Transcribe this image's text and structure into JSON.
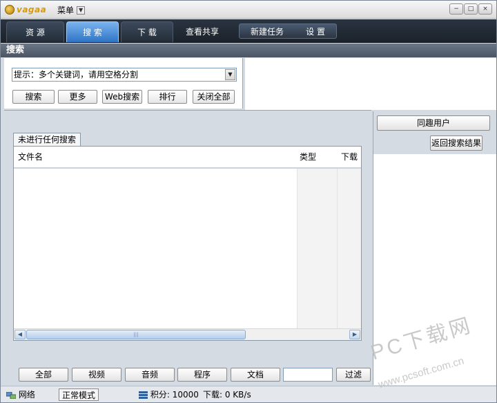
{
  "titlebar": {
    "logo_text": "vagaa",
    "menu_label": "菜单",
    "controls": [
      "−",
      "□",
      "×"
    ]
  },
  "nav": {
    "tabs": [
      "资 源",
      "搜 索",
      "下 载",
      "查看共享"
    ],
    "group": [
      "新建任务",
      "设 置"
    ]
  },
  "section_title": "搜索",
  "search": {
    "hint": "提示：多个关键词，请用空格分割",
    "buttons": [
      "搜索",
      "更多",
      "Web搜索",
      "排行",
      "关闭全部"
    ]
  },
  "results": {
    "tab_label": "未进行任何搜索",
    "columns": [
      "文件名",
      "类型",
      "下载"
    ],
    "scroll_grip": "|||"
  },
  "right_panel": {
    "same_interest": "同趣用户",
    "back_to_results": "返回搜索结果"
  },
  "filters": [
    "全部",
    "视频",
    "音频",
    "程序",
    "文档"
  ],
  "filter_button": "过滤",
  "status": {
    "network": "网络",
    "mode": "正常模式",
    "points": "积分: 10000",
    "download": "下载: 0 KB/s"
  },
  "watermark": {
    "line1": "PC下载网",
    "line2": "www.pcsoft.com.cn"
  },
  "colors": {
    "accent": "#3b7fd0",
    "nav_bg": "#1f2731",
    "section_bg": "#5a6474"
  }
}
